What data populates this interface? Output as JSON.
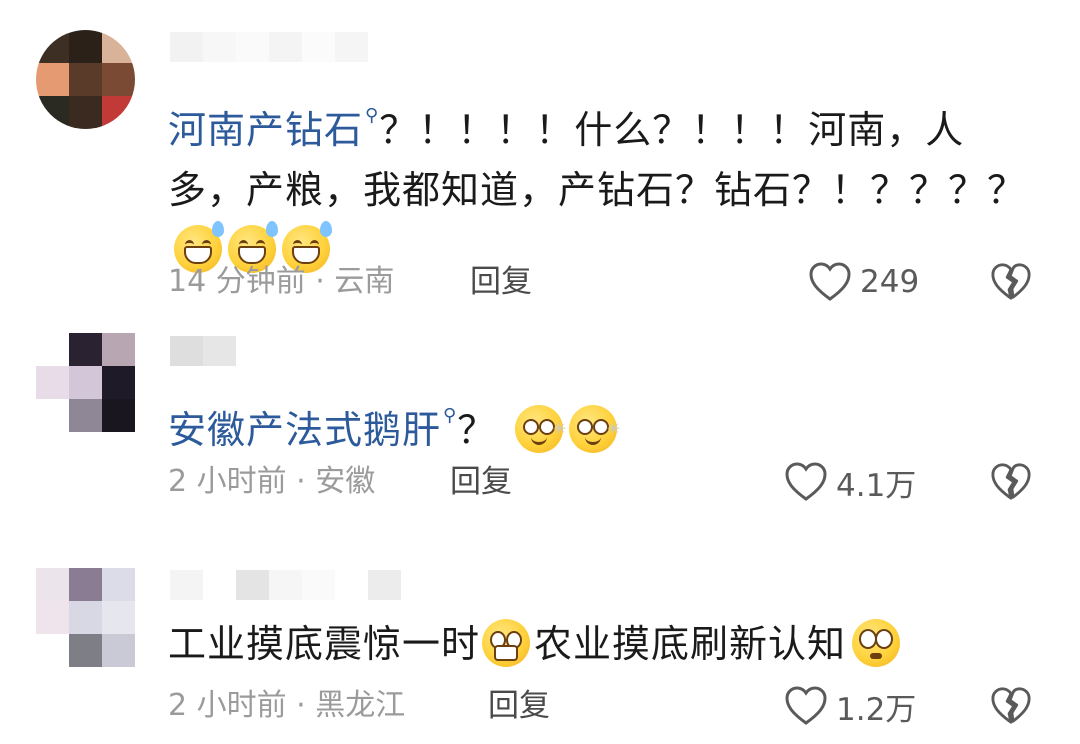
{
  "comments": [
    {
      "text_highlight": "河南产钻石",
      "text_rest": "？！！！！什么？！！！河南，人多，产粮，我都知道，产钻石？钻石？！？？？？",
      "emojis": [
        "grin-sweat-emoji",
        "grin-sweat-emoji",
        "grin-sweat-emoji"
      ],
      "meta": "14 分钟前 · 云南",
      "reply": "回复",
      "likes": "249"
    },
    {
      "text_highlight": "安徽产法式鹅肝",
      "text_rest": "？",
      "emojis": [
        "dizzy-face-emoji",
        "dizzy-face-emoji"
      ],
      "meta": "2 小时前 · 安徽",
      "reply": "回复",
      "likes": "4.1万"
    },
    {
      "text_a": "工业摸底震惊一时",
      "text_b": "农业摸底刷新认知",
      "emojis": [
        "shocked-face-emoji",
        "pleading-face-emoji"
      ],
      "meta": "2 小时前 · 黑龙江",
      "reply": "回复",
      "likes": "1.2万"
    }
  ],
  "colors": {
    "highlight": "#2c5a9b",
    "meta": "#9b9b9b",
    "text": "#1a1a1a"
  },
  "icons": {
    "like": "heart-outline-icon",
    "dislike": "broken-heart-icon",
    "search_superscript": "search-icon"
  }
}
